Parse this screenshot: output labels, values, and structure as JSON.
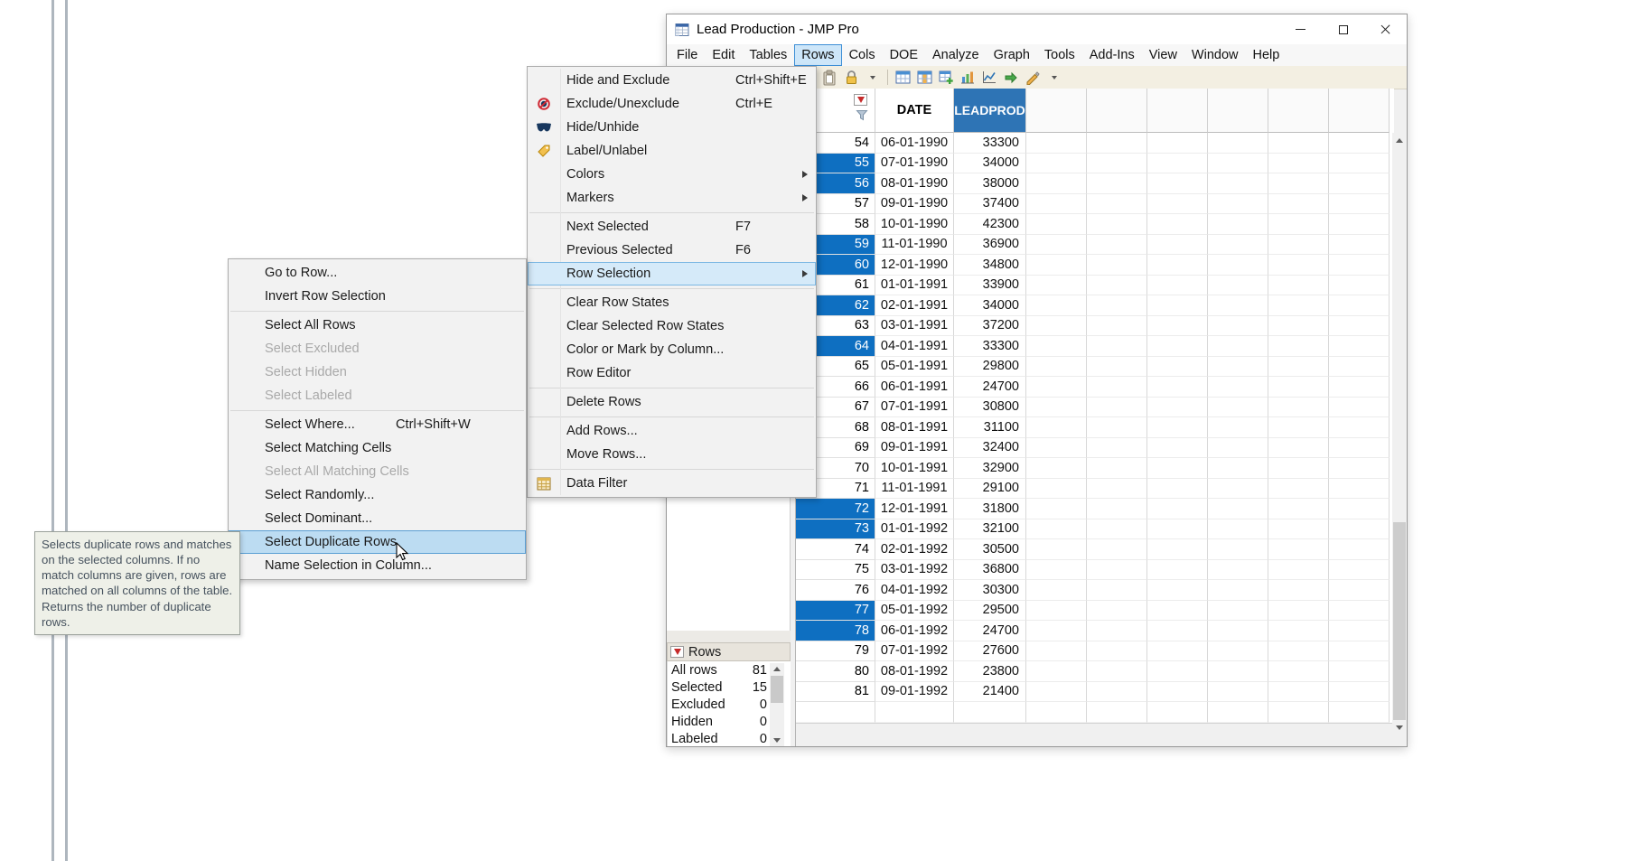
{
  "window": {
    "title": "Lead Production - JMP Pro"
  },
  "menubar": {
    "active_index": 3,
    "items": [
      "File",
      "Edit",
      "Tables",
      "Rows",
      "Cols",
      "DOE",
      "Analyze",
      "Graph",
      "Tools",
      "Add-Ins",
      "View",
      "Window",
      "Help"
    ]
  },
  "toolbar": {
    "icon_groups": [
      [
        "paste-icon",
        "lock-icon",
        "chevron-down-icon"
      ],
      [
        "table-icon",
        "table-columns-icon",
        "table-add-rows-icon",
        "bar-chart-icon",
        "line-chart-icon",
        "export-icon",
        "pencil-icon",
        "chevron-down-icon"
      ]
    ]
  },
  "rows_menu": {
    "items": [
      {
        "type": "item",
        "label": "Hide and Exclude",
        "shortcut": "Ctrl+Shift+E"
      },
      {
        "type": "item",
        "label": "Exclude/Unexclude",
        "shortcut": "Ctrl+E",
        "icon": "exclude-icon"
      },
      {
        "type": "item",
        "label": "Hide/Unhide",
        "icon": "hide-icon"
      },
      {
        "type": "item",
        "label": "Label/Unlabel",
        "icon": "label-icon"
      },
      {
        "type": "item",
        "label": "Colors",
        "submenu": true
      },
      {
        "type": "item",
        "label": "Markers",
        "submenu": true
      },
      {
        "type": "separator"
      },
      {
        "type": "item",
        "label": "Next Selected",
        "shortcut": "F7"
      },
      {
        "type": "item",
        "label": "Previous Selected",
        "shortcut": "F6"
      },
      {
        "type": "item",
        "label": "Row Selection",
        "submenu": true,
        "highlighted": true
      },
      {
        "type": "separator"
      },
      {
        "type": "item",
        "label": "Clear Row States"
      },
      {
        "type": "item",
        "label": "Clear Selected Row States"
      },
      {
        "type": "item",
        "label": "Color or Mark by Column..."
      },
      {
        "type": "item",
        "label": "Row Editor"
      },
      {
        "type": "separator"
      },
      {
        "type": "item",
        "label": "Delete Rows"
      },
      {
        "type": "separator"
      },
      {
        "type": "item",
        "label": "Add Rows..."
      },
      {
        "type": "item",
        "label": "Move Rows..."
      },
      {
        "type": "separator"
      },
      {
        "type": "item",
        "label": "Data Filter",
        "icon": "data-filter-icon"
      }
    ]
  },
  "row_selection_submenu": {
    "items": [
      {
        "type": "item",
        "label": "Go to Row..."
      },
      {
        "type": "item",
        "label": "Invert Row Selection"
      },
      {
        "type": "separator"
      },
      {
        "type": "item",
        "label": "Select All Rows"
      },
      {
        "type": "item",
        "label": "Select Excluded",
        "disabled": true
      },
      {
        "type": "item",
        "label": "Select Hidden",
        "disabled": true
      },
      {
        "type": "item",
        "label": "Select Labeled",
        "disabled": true
      },
      {
        "type": "separator"
      },
      {
        "type": "item",
        "label": "Select Where...",
        "shortcut": "Ctrl+Shift+W"
      },
      {
        "type": "item",
        "label": "Select Matching Cells"
      },
      {
        "type": "item",
        "label": "Select All Matching Cells",
        "disabled": true
      },
      {
        "type": "item",
        "label": "Select Randomly..."
      },
      {
        "type": "item",
        "label": "Select Dominant..."
      },
      {
        "type": "item",
        "label": "Select Duplicate Rows",
        "highlighted": true
      },
      {
        "type": "item",
        "label": "Name Selection in Column..."
      }
    ]
  },
  "tooltip": {
    "text": "Selects duplicate rows and matches on the selected columns. If no match columns are given, rows are matched on all columns of the table. Returns the number of duplicate rows."
  },
  "table": {
    "columns": [
      "DATE",
      "LEADPROD"
    ],
    "empty_columns": 6,
    "rows": [
      {
        "n": "54",
        "date": "06-01-1990",
        "value": "33300",
        "selected": false
      },
      {
        "n": "55",
        "date": "07-01-1990",
        "value": "34000",
        "selected": true
      },
      {
        "n": "56",
        "date": "08-01-1990",
        "value": "38000",
        "selected": true
      },
      {
        "n": "57",
        "date": "09-01-1990",
        "value": "37400",
        "selected": false
      },
      {
        "n": "58",
        "date": "10-01-1990",
        "value": "42300",
        "selected": false
      },
      {
        "n": "59",
        "date": "11-01-1990",
        "value": "36900",
        "selected": true
      },
      {
        "n": "60",
        "date": "12-01-1990",
        "value": "34800",
        "selected": true
      },
      {
        "n": "61",
        "date": "01-01-1991",
        "value": "33900",
        "selected": false
      },
      {
        "n": "62",
        "date": "02-01-1991",
        "value": "34000",
        "selected": true
      },
      {
        "n": "63",
        "date": "03-01-1991",
        "value": "37200",
        "selected": false
      },
      {
        "n": "64",
        "date": "04-01-1991",
        "value": "33300",
        "selected": true
      },
      {
        "n": "65",
        "date": "05-01-1991",
        "value": "29800",
        "selected": false
      },
      {
        "n": "66",
        "date": "06-01-1991",
        "value": "24700",
        "selected": false
      },
      {
        "n": "67",
        "date": "07-01-1991",
        "value": "30800",
        "selected": false
      },
      {
        "n": "68",
        "date": "08-01-1991",
        "value": "31100",
        "selected": false
      },
      {
        "n": "69",
        "date": "09-01-1991",
        "value": "32400",
        "selected": false
      },
      {
        "n": "70",
        "date": "10-01-1991",
        "value": "32900",
        "selected": false
      },
      {
        "n": "71",
        "date": "11-01-1991",
        "value": "29100",
        "selected": false
      },
      {
        "n": "72",
        "date": "12-01-1991",
        "value": "31800",
        "selected": true
      },
      {
        "n": "73",
        "date": "01-01-1992",
        "value": "32100",
        "selected": true
      },
      {
        "n": "74",
        "date": "02-01-1992",
        "value": "30500",
        "selected": false
      },
      {
        "n": "75",
        "date": "03-01-1992",
        "value": "36800",
        "selected": false
      },
      {
        "n": "76",
        "date": "04-01-1992",
        "value": "30300",
        "selected": false
      },
      {
        "n": "77",
        "date": "05-01-1992",
        "value": "29500",
        "selected": true
      },
      {
        "n": "78",
        "date": "06-01-1992",
        "value": "24700",
        "selected": true
      },
      {
        "n": "79",
        "date": "07-01-1992",
        "value": "27600",
        "selected": false
      },
      {
        "n": "80",
        "date": "08-01-1992",
        "value": "23800",
        "selected": false
      },
      {
        "n": "81",
        "date": "09-01-1992",
        "value": "21400",
        "selected": false
      }
    ]
  },
  "rows_panel": {
    "title": "Rows",
    "stats": [
      {
        "label": "All rows",
        "value": "81"
      },
      {
        "label": "Selected",
        "value": "15"
      },
      {
        "label": "Excluded",
        "value": "0"
      },
      {
        "label": "Hidden",
        "value": "0"
      },
      {
        "label": "Labeled",
        "value": "0"
      }
    ]
  },
  "colors": {
    "selected_row_blue": "#0e6fc1",
    "leadprod_header_blue": "#2e74b5",
    "menu_highlight_bg": "#d5eaf9",
    "menu_highlight_border": "#7cb8e3",
    "submenu_highlight_bg": "#bcdcf2",
    "submenu_highlight_border": "#5a9fd4",
    "menubar_active_bg": "#cde6f9",
    "menubar_active_border": "#3d8fd6",
    "tooltip_bg": "#eef0e8"
  }
}
